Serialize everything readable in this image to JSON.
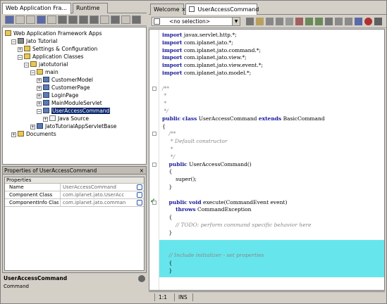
{
  "left_tabs": [
    {
      "label": "Web Application Fra...",
      "close": "×"
    },
    {
      "label": "Runtime"
    }
  ],
  "tree": [
    {
      "label": "Web Application Framework Apps",
      "icon": "app-icon",
      "depth": 0,
      "expander": ""
    },
    {
      "label": "Jato Tutorial",
      "icon": "project-icon",
      "depth": 1,
      "expander": "−"
    },
    {
      "label": "Settings & Configuration",
      "icon": "settings-icon",
      "depth": 2,
      "expander": "+"
    },
    {
      "label": "Application Classes",
      "icon": "folder-icon",
      "depth": 2,
      "expander": "−"
    },
    {
      "label": "jatotutorial",
      "icon": "package-icon",
      "depth": 3,
      "expander": "−"
    },
    {
      "label": "main",
      "icon": "package-icon",
      "depth": 4,
      "expander": "−"
    },
    {
      "label": "CustomerModel",
      "icon": "class-icon",
      "depth": 5,
      "expander": "+"
    },
    {
      "label": "CustomerPage",
      "icon": "class-icon",
      "depth": 5,
      "expander": "+"
    },
    {
      "label": "LoginPage",
      "icon": "class-icon",
      "depth": 5,
      "expander": "+"
    },
    {
      "label": "MainModuleServlet",
      "icon": "class-icon",
      "depth": 5,
      "expander": "+"
    },
    {
      "label": "UserAccessCommand",
      "icon": "class-icon",
      "depth": 5,
      "expander": "−",
      "selected": true
    },
    {
      "label": "Java Source",
      "icon": "source-icon",
      "depth": 6,
      "expander": "+"
    },
    {
      "label": "JatoTutorialAppServletBase",
      "icon": "class-icon",
      "depth": 4,
      "expander": "+"
    },
    {
      "label": "Documents",
      "icon": "folder-icon",
      "depth": 1,
      "expander": "+"
    }
  ],
  "properties": {
    "title": "Properties of UserAccessCommand",
    "close": "×",
    "category": "Properties",
    "rows": [
      {
        "key": "Name",
        "value": "UserAccessCommand"
      },
      {
        "key": "Component Class",
        "value": "com.iplanet.jato.UserAcc"
      },
      {
        "key": "ComponentInfo Class",
        "value": "com.iplanet.jato.comman"
      }
    ]
  },
  "description": {
    "title": "UserAccessCommand",
    "subtitle": "Command"
  },
  "editor_tabs": [
    {
      "label": "Welcome",
      "close": "×"
    },
    {
      "label": "UserAccessCommand",
      "close": "×"
    }
  ],
  "selector": {
    "value": "<no selection>"
  },
  "code_lines": [
    {
      "text": "import javax.servlet.http.*;",
      "kind": "plain"
    },
    {
      "text": "import com.iplanet.jato.*;",
      "kind": "plain"
    },
    {
      "text": "import com.iplanet.jato.command.*;",
      "kind": "plain"
    },
    {
      "text": "import com.iplanet.jato.view.*;",
      "kind": "plain"
    },
    {
      "text": "import com.iplanet.jato.view.event.*;",
      "kind": "plain"
    },
    {
      "text": "import com.iplanet.jato.model.*;",
      "kind": "plain"
    },
    {
      "text": "",
      "kind": "plain"
    },
    {
      "text": "/**",
      "kind": "comment"
    },
    {
      "text": " *",
      "kind": "comment"
    },
    {
      "text": " *",
      "kind": "comment"
    },
    {
      "text": " */",
      "kind": "comment"
    },
    {
      "text": "public class UserAccessCommand extends BasicCommand",
      "kind": "decl"
    },
    {
      "text": "{",
      "kind": "plain"
    },
    {
      "text": "    /**",
      "kind": "comment"
    },
    {
      "text": "     * Default constructor",
      "kind": "comment"
    },
    {
      "text": "     *",
      "kind": "comment"
    },
    {
      "text": "     */",
      "kind": "comment"
    },
    {
      "text": "    public UserAccessCommand()",
      "kind": "decl"
    },
    {
      "text": "    {",
      "kind": "plain"
    },
    {
      "text": "        super();",
      "kind": "plain"
    },
    {
      "text": "    }",
      "kind": "plain"
    },
    {
      "text": "",
      "kind": "plain"
    },
    {
      "text": "    public void execute(CommandEvent event)",
      "kind": "decl"
    },
    {
      "text": "        throws CommandException",
      "kind": "decl"
    },
    {
      "text": "    {",
      "kind": "plain"
    },
    {
      "text": "        // TODO: perform command specific behavior here",
      "kind": "comment"
    },
    {
      "text": "    }",
      "kind": "plain"
    },
    {
      "text": "",
      "kind": "plain"
    },
    {
      "text": "",
      "kind": "plain"
    },
    {
      "text": "    // Include initializer - set properties",
      "kind": "comment"
    },
    {
      "text": "    {",
      "kind": "plain"
    },
    {
      "text": "    }",
      "kind": "plain"
    },
    {
      "text": "",
      "kind": "plain"
    },
    {
      "text": "",
      "kind": "plain"
    },
    {
      "text": "}",
      "kind": "plain"
    }
  ],
  "status": {
    "position": "1:1",
    "mode": "INS"
  },
  "colors": {
    "highlight": "#66e6ec",
    "selection": "#0a246a",
    "keyword": "#1a1a9a"
  }
}
